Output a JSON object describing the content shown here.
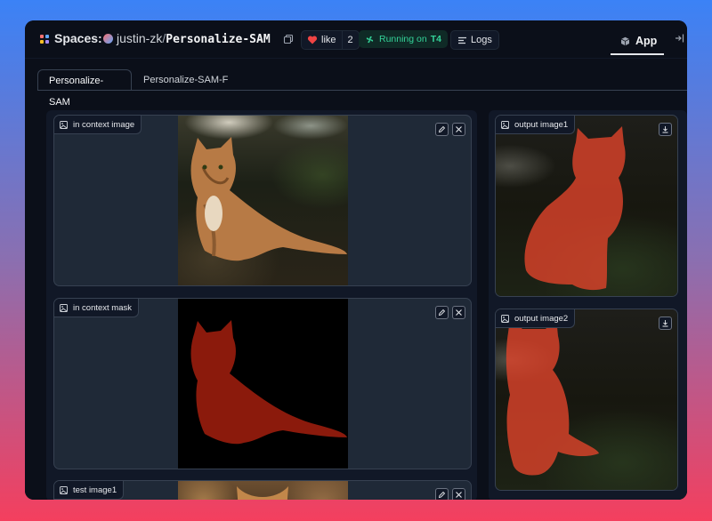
{
  "topbar": {
    "spaces_label": "Spaces:",
    "owner": "justin-zk",
    "separator": "/",
    "repo_name": "Personalize-SAM",
    "like_label": "like",
    "like_count": "2",
    "running_label": "Running on",
    "hardware": "T4",
    "logs_label": "Logs",
    "app_label": "App"
  },
  "tabs": [
    {
      "label": "Personalize-SAM",
      "active": true
    },
    {
      "label": "Personalize-SAM-F",
      "active": false
    }
  ],
  "left_panels": [
    {
      "label": "in context image"
    },
    {
      "label": "in context mask"
    },
    {
      "label": "test image1"
    }
  ],
  "right_panels": [
    {
      "label": "output image1"
    },
    {
      "label": "output image2"
    }
  ],
  "colors": {
    "mask_red": "#8b1a0c",
    "overlay_red": "#e0442a",
    "running_green": "#34d399",
    "like_heart": "#ef4444"
  }
}
